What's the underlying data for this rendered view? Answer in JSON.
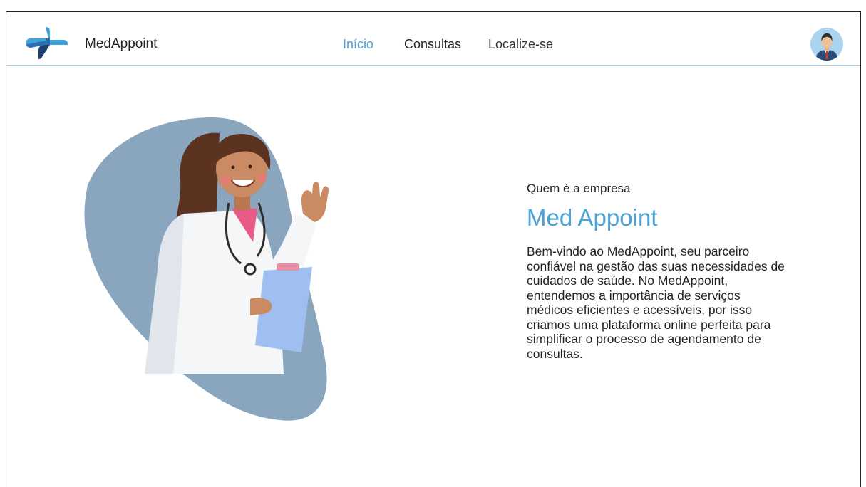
{
  "header": {
    "brand_name": "MedAppoint",
    "nav": [
      {
        "label": "Início",
        "active": true
      },
      {
        "label": "Consultas",
        "active": false
      },
      {
        "label": "Localize-se",
        "active": false
      }
    ]
  },
  "hero": {
    "subtitle": "Quem é a empresa",
    "title": "Med Appoint",
    "description": "Bem-vindo ao MedAppoint, seu parceiro confiável na gestão das suas necessidades de cuidados de saúde. No MedAppoint, entendemos a importância de serviços médicos eficientes e acessíveis, por isso criamos uma plataforma online perfeita para simplificar o processo de agendamento de consultas."
  },
  "colors": {
    "accent": "#4aa3d4",
    "blob": "#8aa6be",
    "logo_dark": "#1f3f70",
    "logo_light": "#3ea3dd"
  },
  "icons": {
    "logo": "medical-cross-logo",
    "avatar": "user-avatar-icon"
  }
}
